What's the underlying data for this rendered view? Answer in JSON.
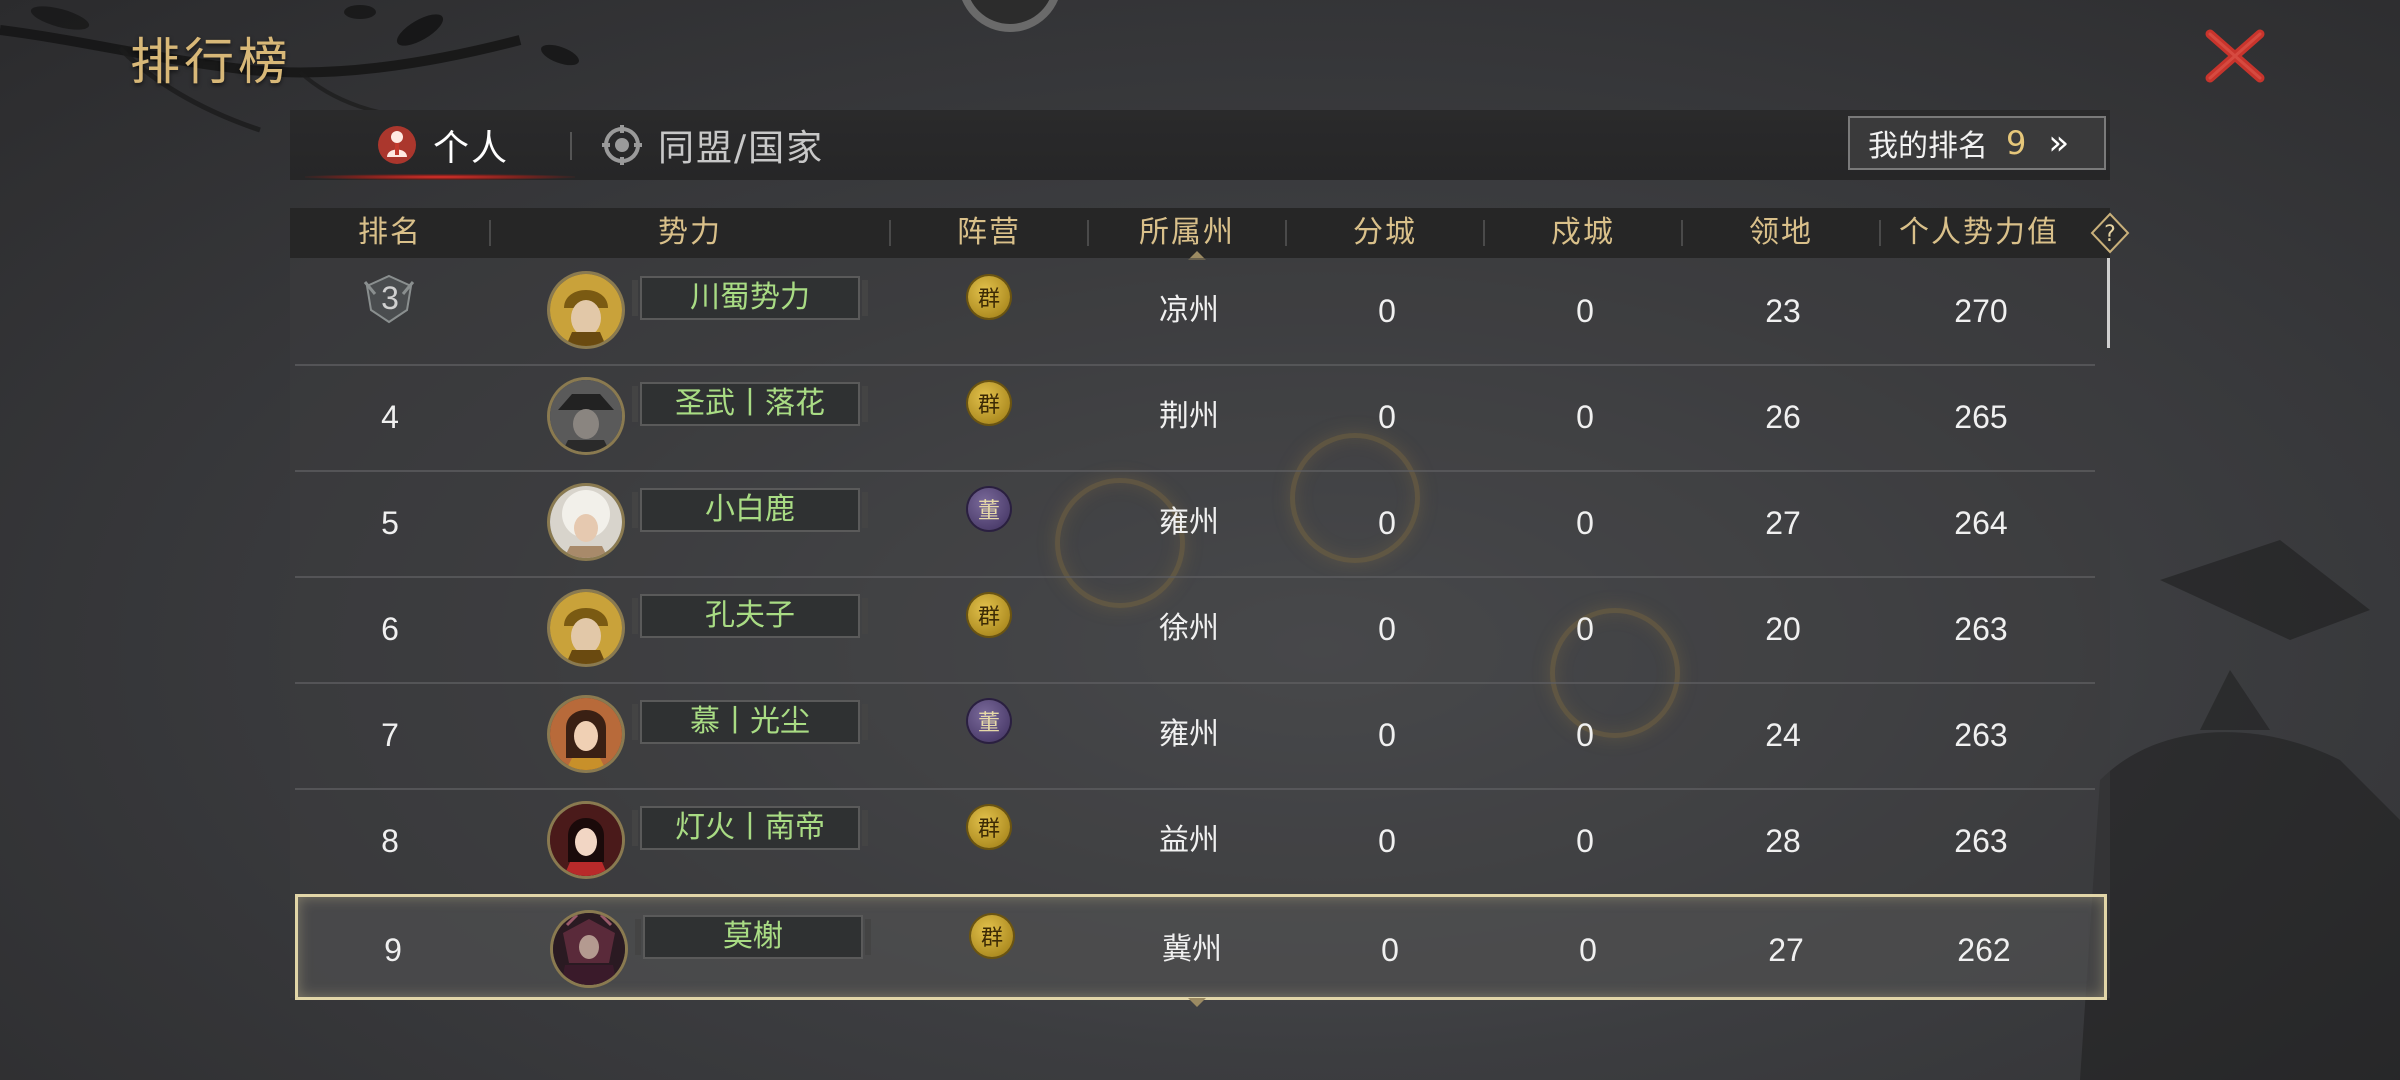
{
  "page": {
    "title": "排行榜"
  },
  "tabs": [
    {
      "label": "个人",
      "active": true,
      "icon": "person-icon"
    },
    {
      "label": "同盟/国家",
      "active": false,
      "icon": "alliance-icon"
    }
  ],
  "my_rank": {
    "label": "我的排名",
    "value": "9",
    "chevron": "»"
  },
  "table": {
    "headers": [
      "排名",
      "势力",
      "阵营",
      "所属州",
      "分城",
      "戍城",
      "领地",
      "个人势力值"
    ],
    "help_symbol": "?",
    "rows": [
      {
        "rank": "3",
        "name": "川蜀势力",
        "faction": "群",
        "faction_type": "qun",
        "state": "凉州",
        "branch": "0",
        "garrison": "0",
        "territory": "23",
        "power": "270",
        "avatar": "gold-helmet-general"
      },
      {
        "rank": "4",
        "name": "圣武丨落花",
        "faction": "群",
        "faction_type": "qun",
        "state": "荆州",
        "branch": "0",
        "garrison": "0",
        "territory": "26",
        "power": "265",
        "avatar": "dark-hat-general"
      },
      {
        "rank": "5",
        "name": "小白鹿",
        "faction": "董",
        "faction_type": "dong",
        "state": "雍州",
        "branch": "0",
        "garrison": "0",
        "territory": "27",
        "power": "264",
        "avatar": "white-hair-general"
      },
      {
        "rank": "6",
        "name": "孔夫子",
        "faction": "群",
        "faction_type": "qun",
        "state": "徐州",
        "branch": "0",
        "garrison": "0",
        "territory": "20",
        "power": "263",
        "avatar": "gold-helmet-general"
      },
      {
        "rank": "7",
        "name": "慕丨光尘",
        "faction": "董",
        "faction_type": "dong",
        "state": "雍州",
        "branch": "0",
        "garrison": "0",
        "territory": "24",
        "power": "263",
        "avatar": "lady-general"
      },
      {
        "rank": "8",
        "name": "灯火丨南帝",
        "faction": "群",
        "faction_type": "qun",
        "state": "益州",
        "branch": "0",
        "garrison": "0",
        "territory": "28",
        "power": "263",
        "avatar": "red-lady-general"
      },
      {
        "rank": "9",
        "name": "莫榭",
        "faction": "群",
        "faction_type": "qun",
        "state": "冀州",
        "branch": "0",
        "garrison": "0",
        "territory": "27",
        "power": "262",
        "avatar": "armored-warrior",
        "highlighted": true
      }
    ]
  },
  "colors": {
    "title_gold": "#d8b878",
    "header_gold": "#d9c08a",
    "name_green": "#a9dc84",
    "close_red": "#c8342c",
    "highlight_border": "#e2d6a8",
    "tab_active_red": "#e0302a"
  },
  "icons": [
    "close-icon",
    "help-icon",
    "rank-badge-icon",
    "double-chevron-icon",
    "faction-qun-icon",
    "faction-dong-icon"
  ]
}
